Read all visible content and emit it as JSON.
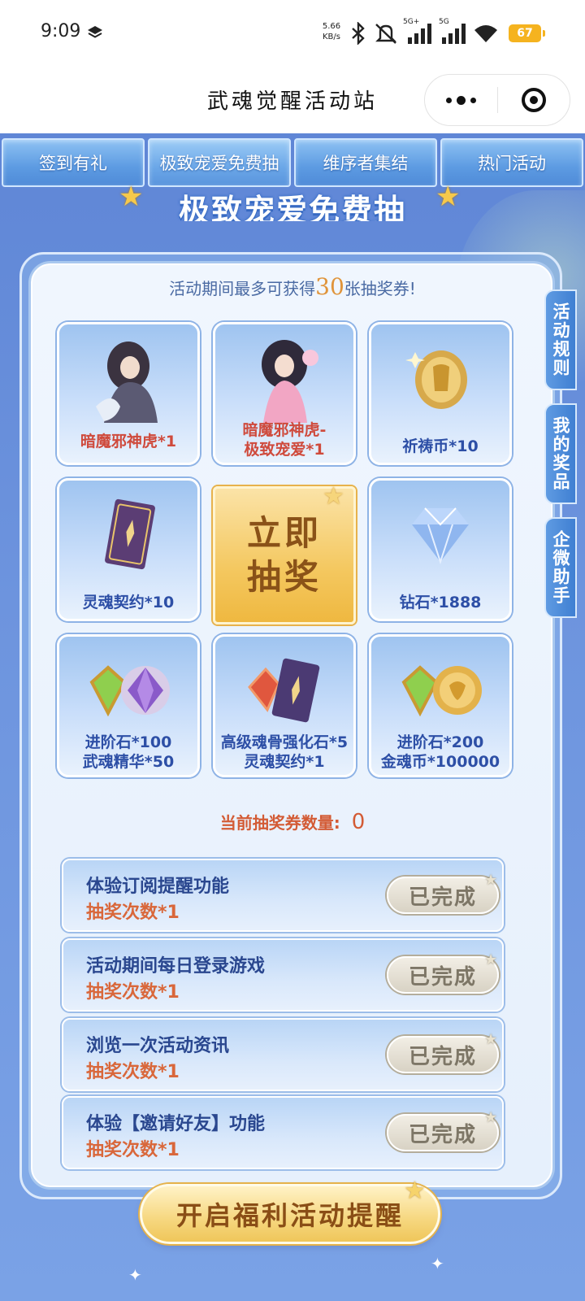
{
  "status_bar": {
    "time": "9:09",
    "net_speed_value": "5.66",
    "net_speed_unit": "KB/s",
    "battery": "67",
    "signal1_label": "5G+",
    "signal2_label": "5G"
  },
  "title_bar": {
    "title": "武魂觉醒活动站"
  },
  "tabs": [
    {
      "label": "签到有礼"
    },
    {
      "label": "极致宠爱免费抽"
    },
    {
      "label": "维序者集结"
    },
    {
      "label": "热门活动"
    }
  ],
  "banner": {
    "title": "极致宠爱免费抽"
  },
  "card": {
    "subtitle_prefix": "活动期间最多可获得",
    "subtitle_number": "30",
    "subtitle_suffix": "张抽奖券!"
  },
  "prizes": [
    {
      "line1": "暗魔邪神虎*1",
      "line2": "",
      "icon": "character-portrait-icon"
    },
    {
      "line1": "暗魔邪神虎-",
      "line2": "极致宠爱*1",
      "icon": "character-skin-icon"
    },
    {
      "line1": "祈祷币*10",
      "line2": "",
      "icon": "gold-coin-icon"
    },
    {
      "line1": "灵魂契约*10",
      "line2": "",
      "icon": "soul-contract-card-icon"
    },
    {
      "line1": "钻石*1888",
      "line2": "",
      "icon": "diamond-icon"
    },
    {
      "line1": "进阶石*100",
      "line2": "武魂精华*50",
      "icon": "green-crystal-icon"
    },
    {
      "line1": "高级魂骨强化石*5",
      "line2": "灵魂契约*1",
      "icon": "red-crystal-card-icon"
    },
    {
      "line1": "进阶石*200",
      "line2": "金魂币*100000",
      "icon": "green-crystal-coin-icon"
    }
  ],
  "draw_button": {
    "line1": "立即",
    "line2": "抽奖"
  },
  "tickets": {
    "label": "当前抽奖券数量:",
    "count": "0"
  },
  "tasks": [
    {
      "title": "体验订阅提醒功能",
      "reward": "抽奖次数*1",
      "button": "已完成"
    },
    {
      "title": "活动期间每日登录游戏",
      "reward": "抽奖次数*1",
      "button": "已完成"
    },
    {
      "title": "浏览一次活动资讯",
      "reward": "抽奖次数*1",
      "button": "已完成"
    },
    {
      "title": "体验【邀请好友】功能",
      "reward": "抽奖次数*1",
      "button": "已完成"
    }
  ],
  "side_tabs": [
    {
      "label": "活动规则"
    },
    {
      "label": "我的奖品"
    },
    {
      "label": "企微助手"
    }
  ],
  "remind_button": {
    "label": "开启福利活动提醒"
  },
  "colors": {
    "primary_blue": "#5f86d6",
    "gold": "#f4c860",
    "reward_red": "#d9673a",
    "label_blue": "#2d4fa6"
  }
}
